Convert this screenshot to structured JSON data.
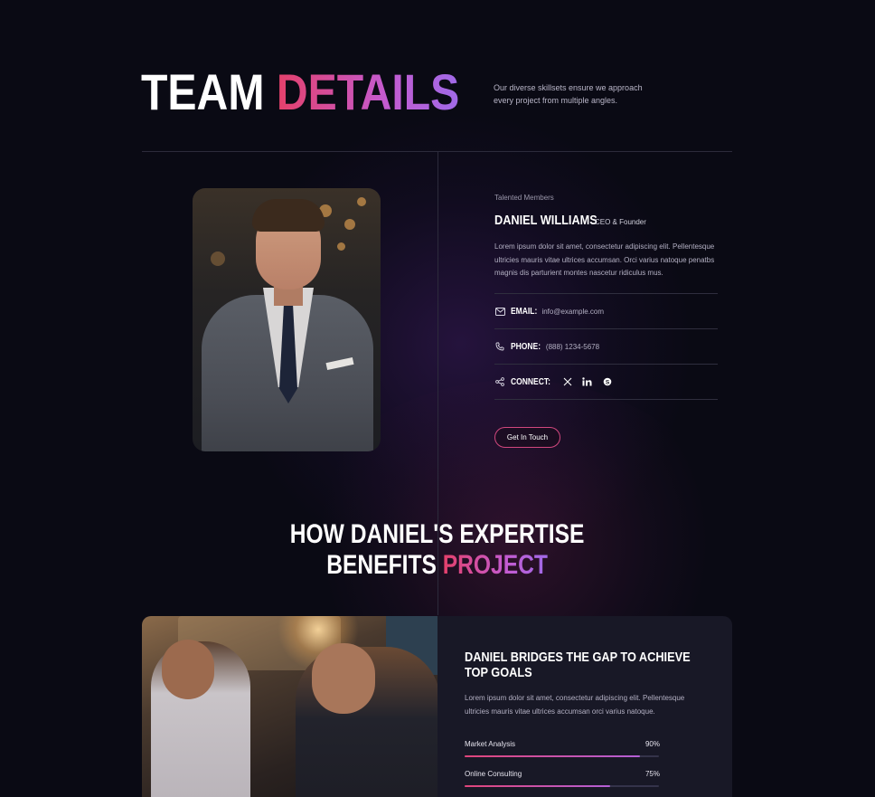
{
  "header": {
    "title_plain": "TEAM",
    "title_accent": "DETAILS",
    "intro": "Our diverse skillsets ensure we approach every project from multiple angles."
  },
  "member": {
    "eyebrow": "Talented Members",
    "name": "DANIEL WILLIAMS",
    "role": "CEO & Founder",
    "bio": "Lorem ipsum dolor sit amet, consectetur adipiscing elit. Pellentesque ultricies mauris vitae ultrices accumsan. Orci varius natoque penatbs magnis dis parturient montes nascetur ridiculus mus.",
    "email_label": "EMAIL:",
    "email_value": "info@example.com",
    "phone_label": "PHONE:",
    "phone_value": "(888) 1234-5678",
    "connect_label": "CONNECT:",
    "socials": [
      "x-icon",
      "linkedin-icon",
      "skype-icon"
    ],
    "cta_label": "Get In Touch"
  },
  "expertise": {
    "heading_line1": "HOW DANIEL'S EXPERTISE",
    "heading_line2_plain": "BENEFITS",
    "heading_line2_accent": "PROJECT"
  },
  "card": {
    "title_line1": "DANIEL BRIDGES THE GAP TO ACHIEVE",
    "title_line2": "TOP GOALS",
    "text": "Lorem ipsum dolor sit amet, consectetur adipiscing elit. Pellentesque ultricies mauris vitae ultrices accumsan orci varius natoque.",
    "skills": [
      {
        "label": "Market Analysis",
        "value": "90%",
        "percent": 90
      },
      {
        "label": "Online Consulting",
        "value": "75%",
        "percent": 75
      }
    ]
  },
  "colors": {
    "background": "#0a0a14",
    "accent_start": "#e4406a",
    "accent_end": "#a06ae8",
    "card": "#181826"
  }
}
